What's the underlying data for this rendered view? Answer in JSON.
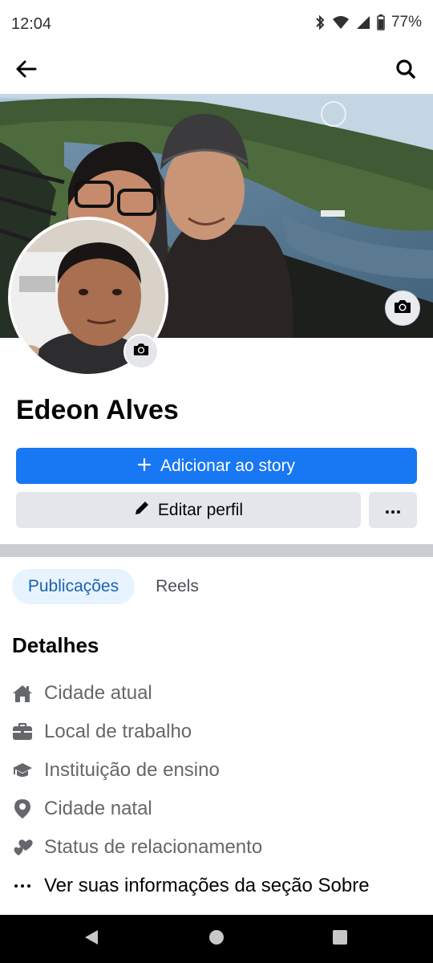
{
  "status_bar": {
    "time": "12:04",
    "battery": "77%",
    "icons": [
      "bluetooth-icon",
      "wifi-icon",
      "signal-icon",
      "battery-icon"
    ]
  },
  "app_bar": {
    "back_icon": "arrow-left-icon",
    "search_icon": "search-icon"
  },
  "profile": {
    "name": "Edeon Alves"
  },
  "actions": {
    "add_story_label": "Adicionar ao story",
    "edit_profile_label": "Editar perfil",
    "more_icon": "more-dots-icon"
  },
  "tabs": [
    {
      "label": "Publicações",
      "selected": true
    },
    {
      "label": "Reels",
      "selected": false
    }
  ],
  "details": {
    "title": "Detalhes",
    "items": [
      {
        "icon": "home-icon",
        "label": "Cidade atual"
      },
      {
        "icon": "briefcase-icon",
        "label": "Local de trabalho"
      },
      {
        "icon": "graduation-cap-icon",
        "label": "Instituição de ensino"
      },
      {
        "icon": "location-pin-icon",
        "label": "Cidade natal"
      },
      {
        "icon": "hearts-icon",
        "label": "Status de relacionamento"
      },
      {
        "icon": "more-dots-icon",
        "label": "Ver suas informações da seção Sobre"
      }
    ]
  },
  "colors": {
    "primary": "#1877f2",
    "secondary_button": "#e4e6eb",
    "tab_selected_bg": "#e7f3ff",
    "tab_selected_text": "#1b62ae",
    "muted_text": "#65676b"
  }
}
